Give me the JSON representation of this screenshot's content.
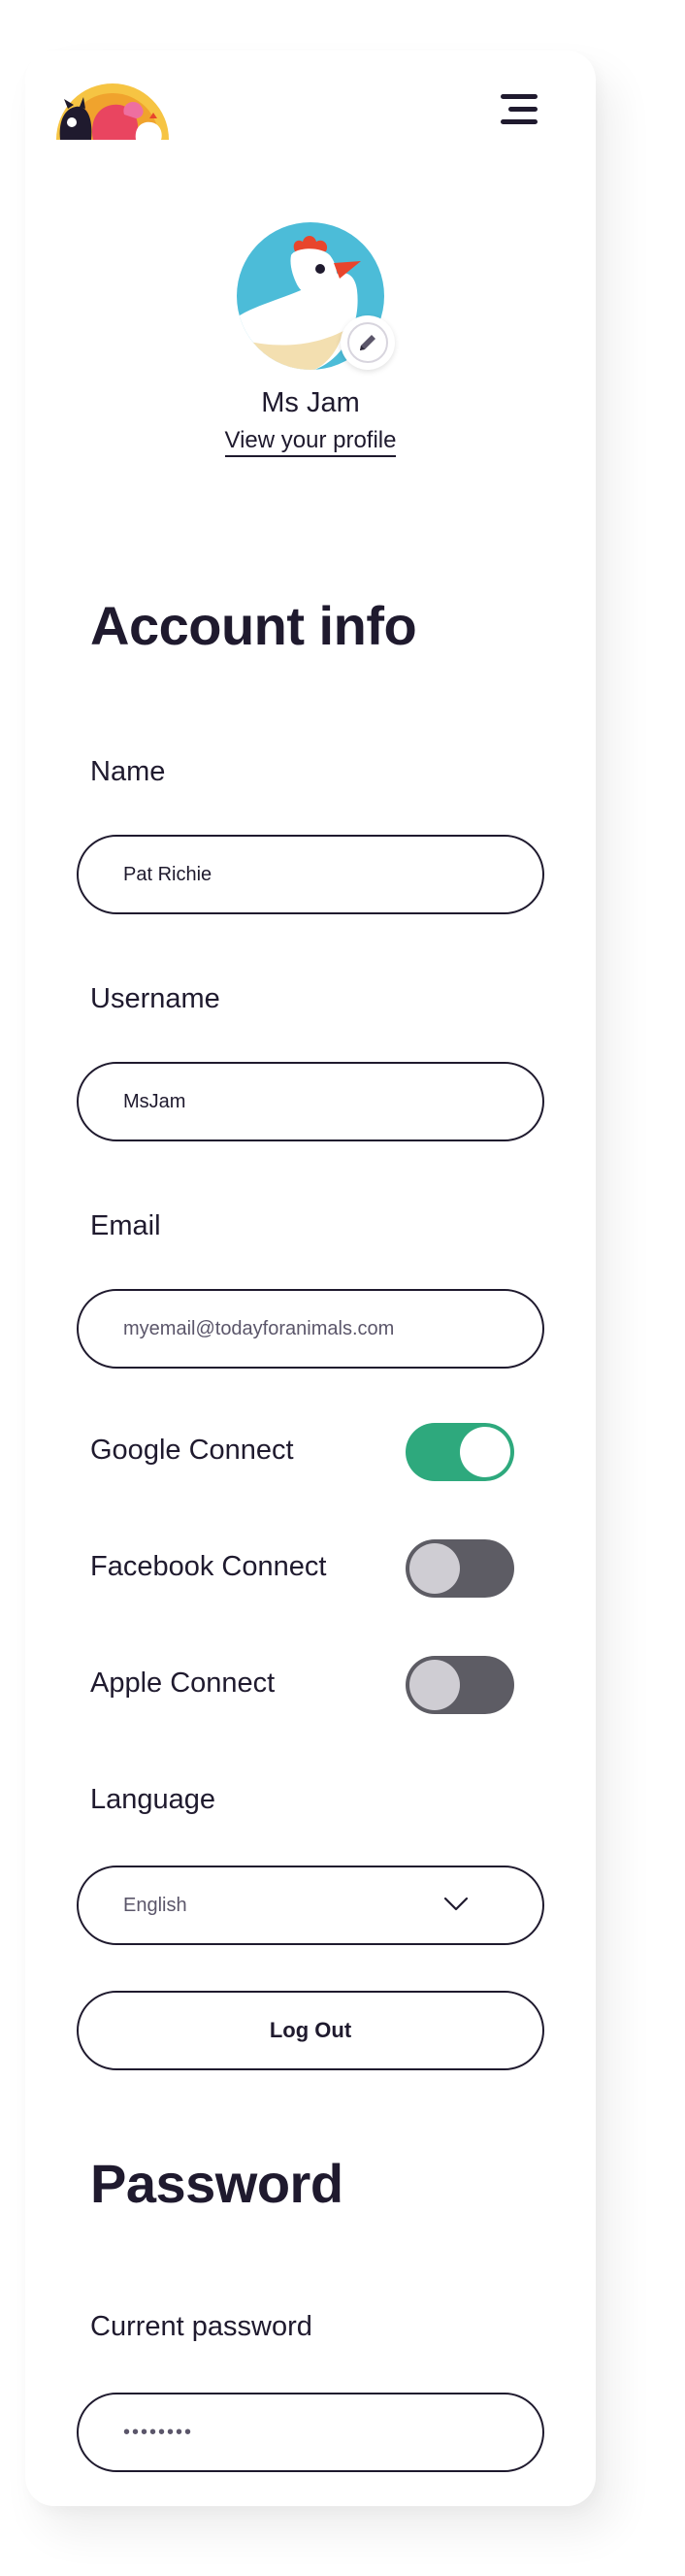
{
  "header": {
    "logo": "farm-animals-logo",
    "menu_icon": "hamburger-menu-icon"
  },
  "profile": {
    "avatar": "chicken-avatar",
    "edit_icon": "pencil-icon",
    "name": "Ms Jam",
    "view_link": "View your profile"
  },
  "account": {
    "title": "Account info",
    "name_label": "Name",
    "name_value": "Pat Richie",
    "username_label": "Username",
    "username_value": "MsJam",
    "email_label": "Email",
    "email_value": "myemail@todayforanimals.com",
    "connections": [
      {
        "label": "Google Connect",
        "enabled": true
      },
      {
        "label": "Facebook Connect",
        "enabled": false
      },
      {
        "label": "Apple Connect",
        "enabled": false
      }
    ],
    "language_label": "Language",
    "language_value": "English",
    "logout_label": "Log Out"
  },
  "password": {
    "title": "Password",
    "current_label": "Current password",
    "current_value": "••••••••"
  },
  "colors": {
    "toggle_on": "#2ea97d",
    "toggle_off": "#5d5c64",
    "text": "#1f1a2e",
    "avatar_sky": "#4cbcd8"
  }
}
